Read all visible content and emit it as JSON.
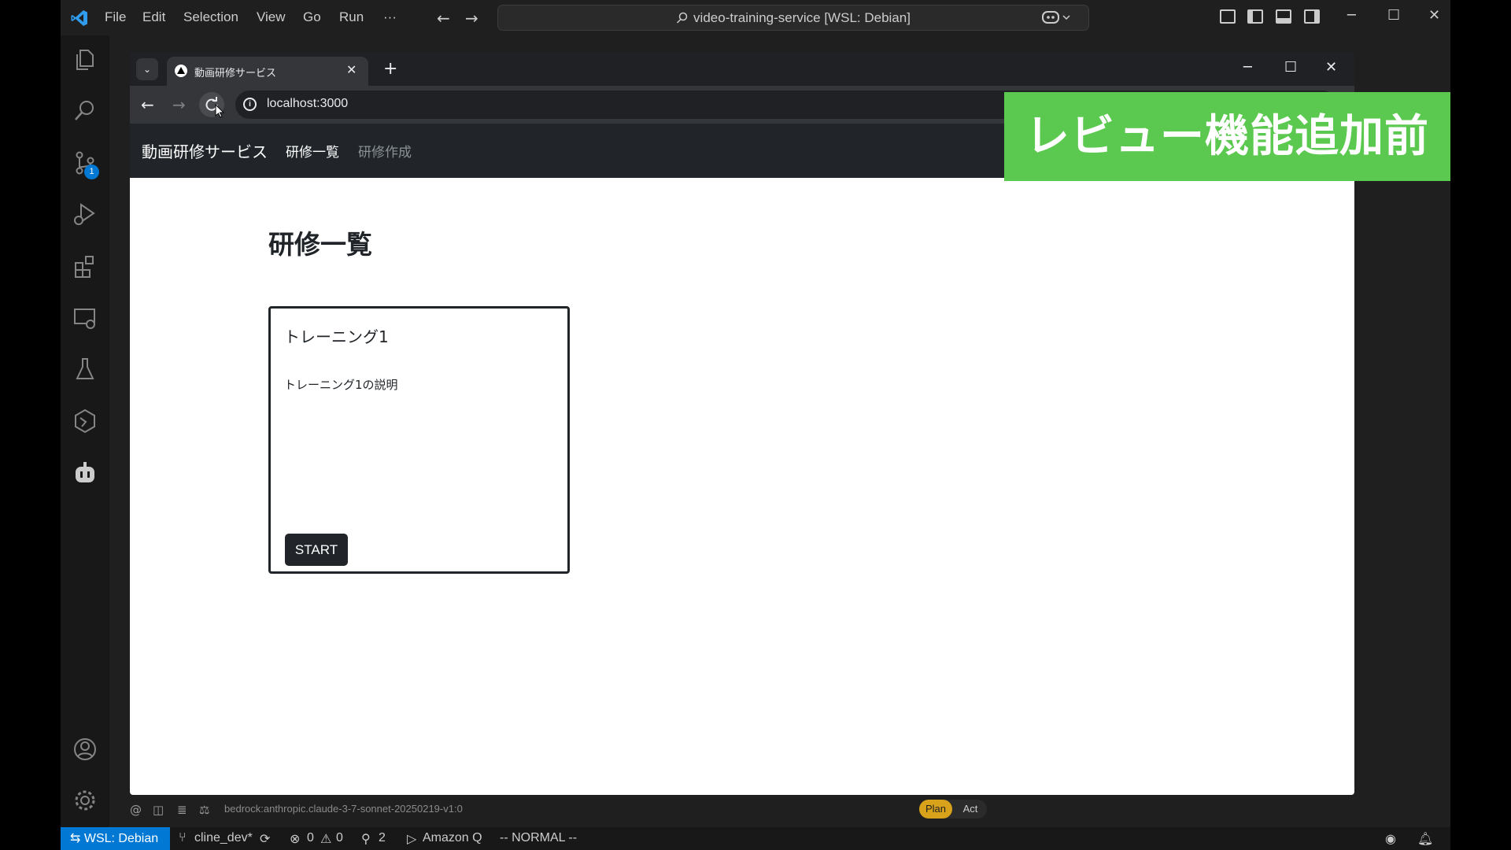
{
  "vscode": {
    "menu": [
      "File",
      "Edit",
      "Selection",
      "View",
      "Go",
      "Run",
      "···"
    ],
    "command_center": "video-training-service [WSL: Debian]",
    "source_control_badge": "1"
  },
  "browser": {
    "tab_title": "動画研修サービス",
    "url": "localhost:3000"
  },
  "app": {
    "brand": "動画研修サービス",
    "nav": [
      "研修一覧",
      "研修作成"
    ],
    "page_title": "研修一覧",
    "cards": [
      {
        "title": "トレーニング1",
        "description": "トレーニング1の説明",
        "button": "START"
      }
    ]
  },
  "banner": "レビュー機能追加前",
  "bottom_toolbar": {
    "model": "bedrock:anthropic.claude-3-7-sonnet-20250219-v1:0",
    "plan": "Plan",
    "act": "Act"
  },
  "statusbar": {
    "remote": "WSL: Debian",
    "branch": "cline_dev*",
    "errors": "0",
    "warnings": "0",
    "ports": "2",
    "amazon_q": "Amazon Q",
    "mode": "-- NORMAL --"
  }
}
